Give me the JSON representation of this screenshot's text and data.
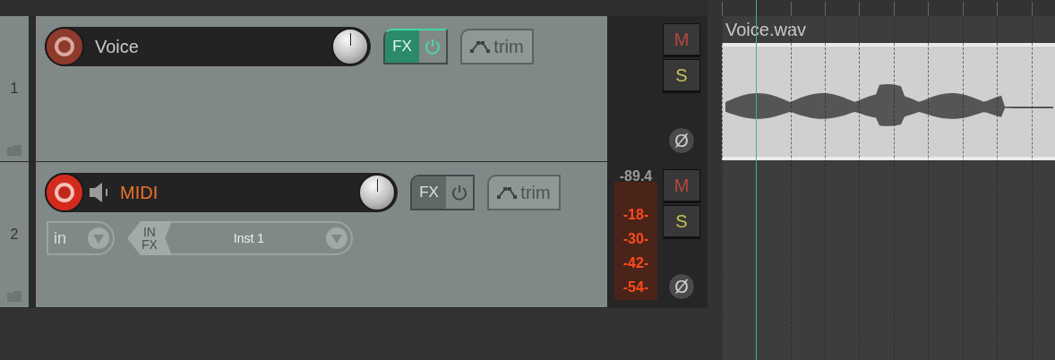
{
  "tracks": [
    {
      "number": "1",
      "name": "Voice",
      "kind": "audio",
      "armed": false,
      "fx_active": true,
      "fx_label": "FX",
      "trim_label": "trim",
      "mute_label": "M",
      "solo_label": "S",
      "phase_label": "Ø"
    },
    {
      "number": "2",
      "name": "MIDI",
      "kind": "midi",
      "armed": true,
      "fx_active": false,
      "fx_label": "FX",
      "trim_label": "trim",
      "mute_label": "M",
      "solo_label": "S",
      "phase_label": "Ø",
      "input": "in",
      "insert_label": "IN FX",
      "instrument": "Inst 1",
      "meter": {
        "reading": "-89.4",
        "scale": [
          "-18-",
          "-30-",
          "-42-",
          "-54-"
        ]
      }
    }
  ],
  "arrange": {
    "items": [
      {
        "title": "Voice.wav"
      }
    ]
  }
}
